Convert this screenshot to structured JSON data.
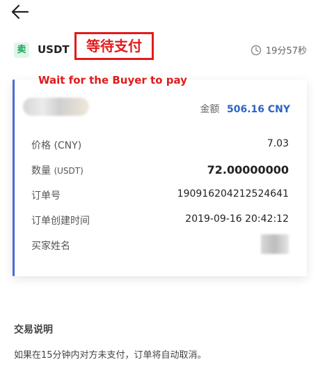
{
  "header": {
    "back_icon": "arrow-left-icon"
  },
  "order": {
    "side_label": "卖",
    "asset": "USDT",
    "status": "等待支付",
    "countdown_icon": "clock-icon",
    "countdown": "19分57秒",
    "annotation": "Wait for the Buyer to pay"
  },
  "card": {
    "amount_label": "金额",
    "amount_value": "506.16 CNY",
    "rows": [
      {
        "label": "价格 (CNY)",
        "value": "7.03"
      },
      {
        "label": "数量",
        "unit": "(USDT)",
        "value": "72.00000000"
      },
      {
        "label": "订单号",
        "value": "190916204212524641"
      },
      {
        "label": "订单创建时间",
        "value": "2019-09-16 20:42:12"
      },
      {
        "label": "买家姓名",
        "value": ""
      }
    ]
  },
  "description": {
    "title": "交易说明",
    "text": "如果在15分钟内对方未支付，订单将自动取消。"
  },
  "colors": {
    "status_red": "#e21b1b",
    "accent_blue": "#2d63c7",
    "card_border": "#4a6ad8",
    "sell_green": "#1aa35a"
  }
}
